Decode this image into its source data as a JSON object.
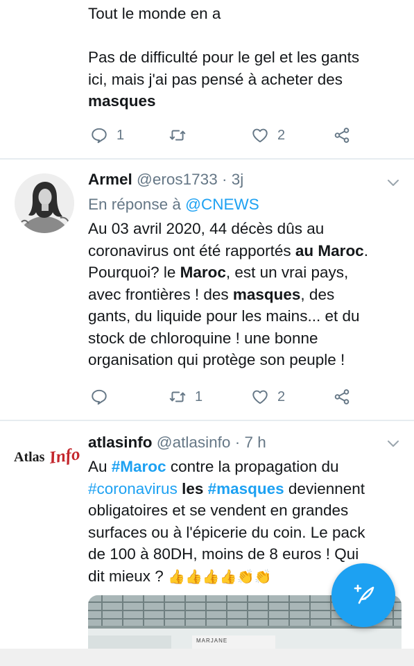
{
  "tweet1": {
    "line1": "Tout le monde en a",
    "line2": "Pas de difficulté pour le gel et les gants",
    "line3": "ici, mais j'ai pas pensé à acheter des",
    "line4_bold": "masques",
    "reply_count": "1",
    "retweet_count": "",
    "like_count": "2"
  },
  "tweet2": {
    "name": "Armel",
    "handle": "@eros1733",
    "time": "· 3j",
    "reply_prefix": "En réponse à",
    "reply_to": "@CNEWS",
    "l1": "Au 03 avril 2020, 44 décès dûs au",
    "l2_a": "coronavirus ont été rapportés ",
    "l2_b": "au Maroc",
    "l2_c": ".",
    "l3_a": "Pourquoi? le ",
    "l3_b": "Maroc",
    "l3_c": ", est un vrai pays,",
    "l4_a": "avec frontières ! des ",
    "l4_b": "masques",
    "l4_c": ", des",
    "l5": "gants, du liquide pour les mains... et du",
    "l6": "stock de chloroquine ! une bonne",
    "l7": "organisation qui protège son peuple !",
    "reply_count": "",
    "retweet_count": "1",
    "like_count": "2"
  },
  "tweet3": {
    "name": "atlasinfo",
    "handle": "@atlasinfo",
    "time": "· 7 h",
    "logo_text_1": "Atlas",
    "logo_text_2": "Info",
    "l1_a": "Au ",
    "l1_b": "#Maroc",
    "l1_c": " contre la propagation du",
    "l2_a": "#coronavirus",
    "l2_b": " les ",
    "l2_c": "#masques",
    "l2_d": " deviennent",
    "l3": "obligatoires et se vendent en grandes",
    "l4": "surfaces ou à l'épicerie du coin. Le pack",
    "l5": "de 100 à 80DH, moins de 8 euros ! Qui",
    "l6": "dit mieux  ?",
    "emoji": "👍👍👍👍👏👏",
    "media_sign": "MARJANE"
  },
  "colors": {
    "accent": "#1da1f2",
    "muted": "#657786",
    "divider": "#e6ecf0"
  }
}
